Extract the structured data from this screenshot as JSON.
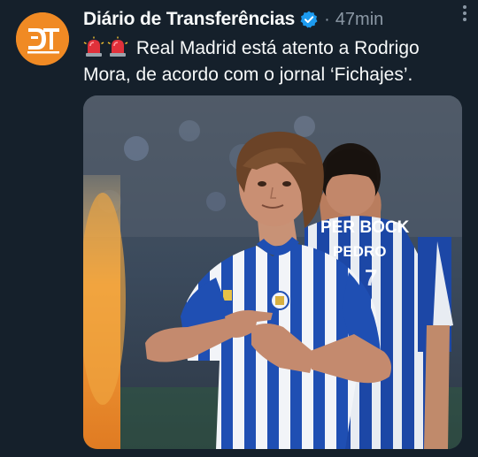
{
  "tweet": {
    "author_name": "Diário de Transferências",
    "separator": "·",
    "timestamp": "47min",
    "text": "Real Madrid está atento a Rodrigo Mora, de acordo com o jornal ‘Fichajes’.",
    "emoji_icons": [
      "police-light-icon",
      "police-light-icon"
    ],
    "avatar_initials": "DT",
    "verified_icon": "verified-badge-icon",
    "more_icon": "more-options-icon"
  },
  "media": {
    "jersey_sponsor_text": "PER BOCK",
    "jersey_back_name": "PEDRO",
    "jersey_back_number": "7",
    "colors": {
      "jersey_blue": "#1f4fb3",
      "jersey_white": "#f2f4f8",
      "flare": "#f0a640"
    }
  },
  "colors": {
    "background": "#15202b",
    "text_primary": "#f7f9f9",
    "text_secondary": "#8b98a5",
    "verified": "#1d9bf0",
    "avatar": "#f08a24"
  }
}
